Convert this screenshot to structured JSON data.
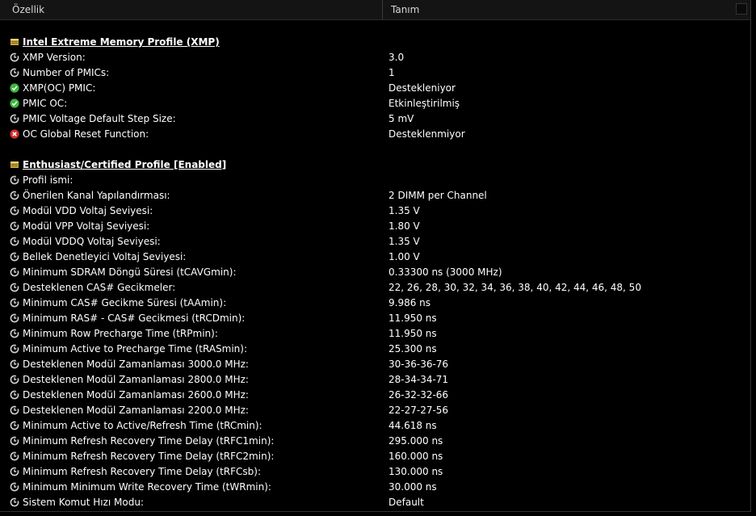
{
  "columns": {
    "property": "Özellik",
    "value": "Tanım"
  },
  "sections": [
    {
      "title": "Intel Extreme Memory Profile (XMP)",
      "rows": [
        {
          "icon": "clock-icon",
          "label": "XMP Version:",
          "value": "3.0"
        },
        {
          "icon": "clock-icon",
          "label": "Number of PMICs:",
          "value": "1"
        },
        {
          "icon": "check-icon",
          "label": "XMP(OC) PMIC:",
          "value": "Destekleniyor"
        },
        {
          "icon": "check-icon",
          "label": "PMIC OC:",
          "value": "Etkinleştirilmiş"
        },
        {
          "icon": "clock-icon",
          "label": "PMIC Voltage Default Step Size:",
          "value": "5 mV"
        },
        {
          "icon": "error-icon",
          "label": "OC Global Reset Function:",
          "value": "Desteklenmiyor"
        }
      ]
    },
    {
      "title": "Enthusiast/Certified Profile [Enabled]",
      "rows": [
        {
          "icon": "clock-icon",
          "label": "Profil ismi:",
          "value": ""
        },
        {
          "icon": "clock-icon",
          "label": "Önerilen Kanal Yapılandırması:",
          "value": "2 DIMM per Channel"
        },
        {
          "icon": "clock-icon",
          "label": "Modül VDD Voltaj Seviyesi:",
          "value": "1.35 V"
        },
        {
          "icon": "clock-icon",
          "label": "Modül VPP Voltaj Seviyesi:",
          "value": "1.80 V"
        },
        {
          "icon": "clock-icon",
          "label": "Modül VDDQ Voltaj Seviyesi:",
          "value": "1.35 V"
        },
        {
          "icon": "clock-icon",
          "label": "Bellek Denetleyici Voltaj Seviyesi:",
          "value": "1.00 V"
        },
        {
          "icon": "clock-icon",
          "label": "Minimum SDRAM Döngü Süresi (tCAVGmin):",
          "value": "0.33300 ns (3000 MHz)"
        },
        {
          "icon": "clock-icon",
          "label": "Desteklenen CAS# Gecikmeler:",
          "value": "22, 26, 28, 30, 32, 34, 36, 38, 40, 42, 44, 46, 48, 50"
        },
        {
          "icon": "clock-icon",
          "label": "Minimum CAS# Gecikme Süresi (tAAmin):",
          "value": "9.986 ns"
        },
        {
          "icon": "clock-icon",
          "label": "Minimum RAS# - CAS# Gecikmesi (tRCDmin):",
          "value": "11.950 ns"
        },
        {
          "icon": "clock-icon",
          "label": "Minimum Row Precharge Time (tRPmin):",
          "value": "11.950 ns"
        },
        {
          "icon": "clock-icon",
          "label": "Minimum Active to Precharge Time (tRASmin):",
          "value": "25.300 ns"
        },
        {
          "icon": "clock-icon",
          "label": "Desteklenen Modül Zamanlaması 3000.0 MHz:",
          "value": "30-36-36-76"
        },
        {
          "icon": "clock-icon",
          "label": "Desteklenen Modül Zamanlaması 2800.0 MHz:",
          "value": "28-34-34-71"
        },
        {
          "icon": "clock-icon",
          "label": "Desteklenen Modül Zamanlaması 2600.0 MHz:",
          "value": "26-32-32-66"
        },
        {
          "icon": "clock-icon",
          "label": "Desteklenen Modül Zamanlaması 2200.0 MHz:",
          "value": "22-27-27-56"
        },
        {
          "icon": "clock-icon",
          "label": "Minimum Active to Active/Refresh Time (tRCmin):",
          "value": "44.618 ns"
        },
        {
          "icon": "clock-icon",
          "label": "Minimum Refresh Recovery Time Delay (tRFC1min):",
          "value": "295.000 ns"
        },
        {
          "icon": "clock-icon",
          "label": "Minimum Refresh Recovery Time Delay (tRFC2min):",
          "value": "160.000 ns"
        },
        {
          "icon": "clock-icon",
          "label": "Minimum Refresh Recovery Time Delay (tRFCsb):",
          "value": "130.000 ns"
        },
        {
          "icon": "clock-icon",
          "label": "Minimum Minimum Write Recovery Time (tWRmin):",
          "value": "30.000 ns"
        },
        {
          "icon": "clock-icon",
          "label": "Sistem Komut Hızı Modu:",
          "value": "Default"
        }
      ]
    }
  ],
  "colors": {
    "background": "#000000",
    "text": "#ffffff",
    "header": "#141414",
    "ok": "#3db83d",
    "error": "#d42b2b"
  }
}
